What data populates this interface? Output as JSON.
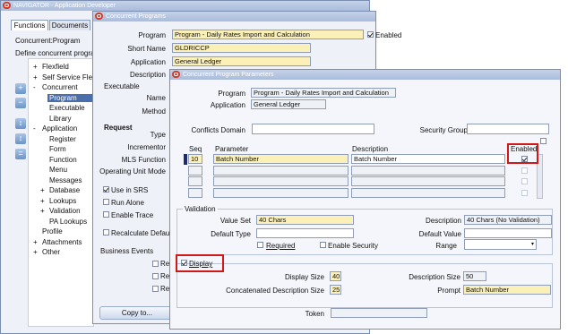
{
  "navigator": {
    "title": "NAVIGATOR - Application Developer",
    "tabs": [
      "Functions",
      "Documents"
    ],
    "responsibility": "Concurrent:Program",
    "hint": "Define concurrent program",
    "tree": [
      {
        "marker": "+",
        "label": "Flexfield"
      },
      {
        "marker": "+",
        "label": "Self Service Flex"
      },
      {
        "marker": "-",
        "label": "Concurrent"
      },
      {
        "marker": "",
        "label": "Program"
      },
      {
        "marker": "",
        "label": "Executable"
      },
      {
        "marker": "",
        "label": "Library"
      },
      {
        "marker": "-",
        "label": "Application"
      },
      {
        "marker": "",
        "label": "Register"
      },
      {
        "marker": "",
        "label": "Form"
      },
      {
        "marker": "",
        "label": "Function"
      },
      {
        "marker": "",
        "label": "Menu"
      },
      {
        "marker": "",
        "label": "Messages"
      },
      {
        "marker": "+",
        "label": "Database"
      },
      {
        "marker": "+",
        "label": "Lookups"
      },
      {
        "marker": "+",
        "label": "Validation"
      },
      {
        "marker": "",
        "label": "PA Lookups"
      },
      {
        "marker": "",
        "label": "Profile"
      },
      {
        "marker": "+",
        "label": "Attachments"
      },
      {
        "marker": "+",
        "label": "Other"
      }
    ]
  },
  "conc": {
    "title": "Concurrent Programs",
    "program_label": "Program",
    "program_value": "Program - Daily Rates Import and Calculation",
    "enabled_label": "Enabled",
    "short_name_label": "Short Name",
    "short_name_value": "GLDRICCP",
    "application_label": "Application",
    "application_value": "General Ledger",
    "description_label": "Description",
    "executable_section": "Executable",
    "name_label": "Name",
    "method_label": "Method",
    "request_section": "Request",
    "type_label": "Type",
    "incrementor_label": "Incrementor",
    "mls_label": "MLS Function",
    "opmode_label": "Operating Unit Mode",
    "use_srs": "Use in SRS",
    "run_alone": "Run Alone",
    "enable_trace": "Enable Trace",
    "recalc": "Recalculate Default P",
    "business_events": "Business Events",
    "req_stub": "Requ",
    "copy_button": "Copy to..."
  },
  "params": {
    "title": "Concurrent Program Parameters",
    "program_label": "Program",
    "program_value": "Program - Daily Rates Import and Calculation",
    "application_label": "Application",
    "application_value": "General Ledger",
    "conflicts_label": "Conflicts Domain",
    "security_label": "Security Group",
    "col_seq": "Seq",
    "col_parameter": "Parameter",
    "col_description": "Description",
    "col_enabled": "Enabled",
    "rows": [
      {
        "seq": "10",
        "parameter": "Batch Number",
        "description": "Batch Number",
        "enabled": true
      },
      {
        "seq": "",
        "parameter": "",
        "description": "",
        "enabled": false
      },
      {
        "seq": "",
        "parameter": "",
        "description": "",
        "enabled": false
      },
      {
        "seq": "",
        "parameter": "",
        "description": "",
        "enabled": false
      }
    ],
    "validation_section": "Validation",
    "value_set_label": "Value Set",
    "value_set_value": "40 Chars",
    "vs_description_label": "Description",
    "vs_description_value": "40 Chars (No Validation)",
    "default_type_label": "Default Type",
    "default_value_label": "Default Value",
    "required_label": "Required",
    "enable_security_label": "Enable Security",
    "range_label": "Range",
    "display_label": "Display",
    "display_size_label": "Display Size",
    "display_size_value": "40",
    "desc_size_label": "Description Size",
    "desc_size_value": "50",
    "concat_size_label": "Concatenated Description Size",
    "concat_size_value": "25",
    "prompt_label": "Prompt",
    "prompt_value": "Batch Number",
    "token_label": "Token"
  },
  "colors": {
    "titlebar": "#a9bcdc",
    "required_field": "#fbf0b8",
    "highlight": "#d01818"
  }
}
